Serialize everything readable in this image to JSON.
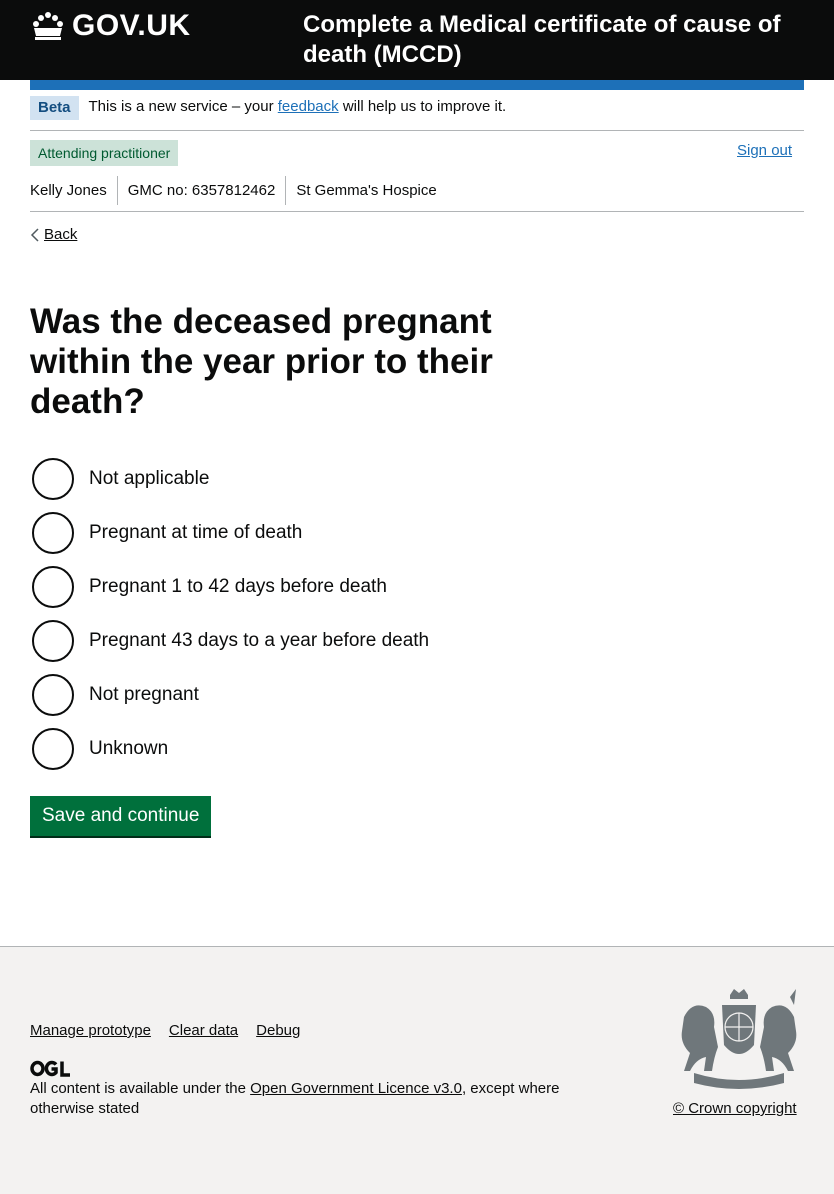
{
  "header": {
    "logo_text": "GOV.UK",
    "service_name": "Complete a Medical certificate of cause of death (MCCD)"
  },
  "phase_banner": {
    "tag": "Beta",
    "text_before": "This is a new service – your ",
    "feedback_link": "feedback",
    "text_after": " will help us to improve it."
  },
  "user": {
    "role": "Attending practitioner",
    "sign_out": "Sign out",
    "name": "Kelly Jones",
    "gmc": "GMC no: 6357812462",
    "organisation": "St Gemma's Hospice"
  },
  "back_link": "Back",
  "question": "Was the deceased pregnant within the year prior to their death?",
  "options": [
    {
      "label": "Not applicable",
      "selected": false
    },
    {
      "label": "Pregnant at time of death",
      "selected": false
    },
    {
      "label": "Pregnant 1 to 42 days before death",
      "selected": false
    },
    {
      "label": "Pregnant 43 days to a year before death",
      "selected": false
    },
    {
      "label": "Not pregnant",
      "selected": false
    },
    {
      "label": "Unknown",
      "selected": false
    }
  ],
  "submit_button": "Save and continue",
  "footer": {
    "links": [
      "Manage prototype",
      "Clear data",
      "Debug"
    ],
    "licence_before": "All content is available under the ",
    "licence_link": "Open Government Licence v3.0",
    "licence_after": ", except where otherwise stated",
    "copyright": "© Crown copyright"
  },
  "colors": {
    "header_bg": "#0b0c0c",
    "brand_blue": "#1d70b8",
    "button_green": "#00703c",
    "footer_bg": "#f3f2f1"
  }
}
